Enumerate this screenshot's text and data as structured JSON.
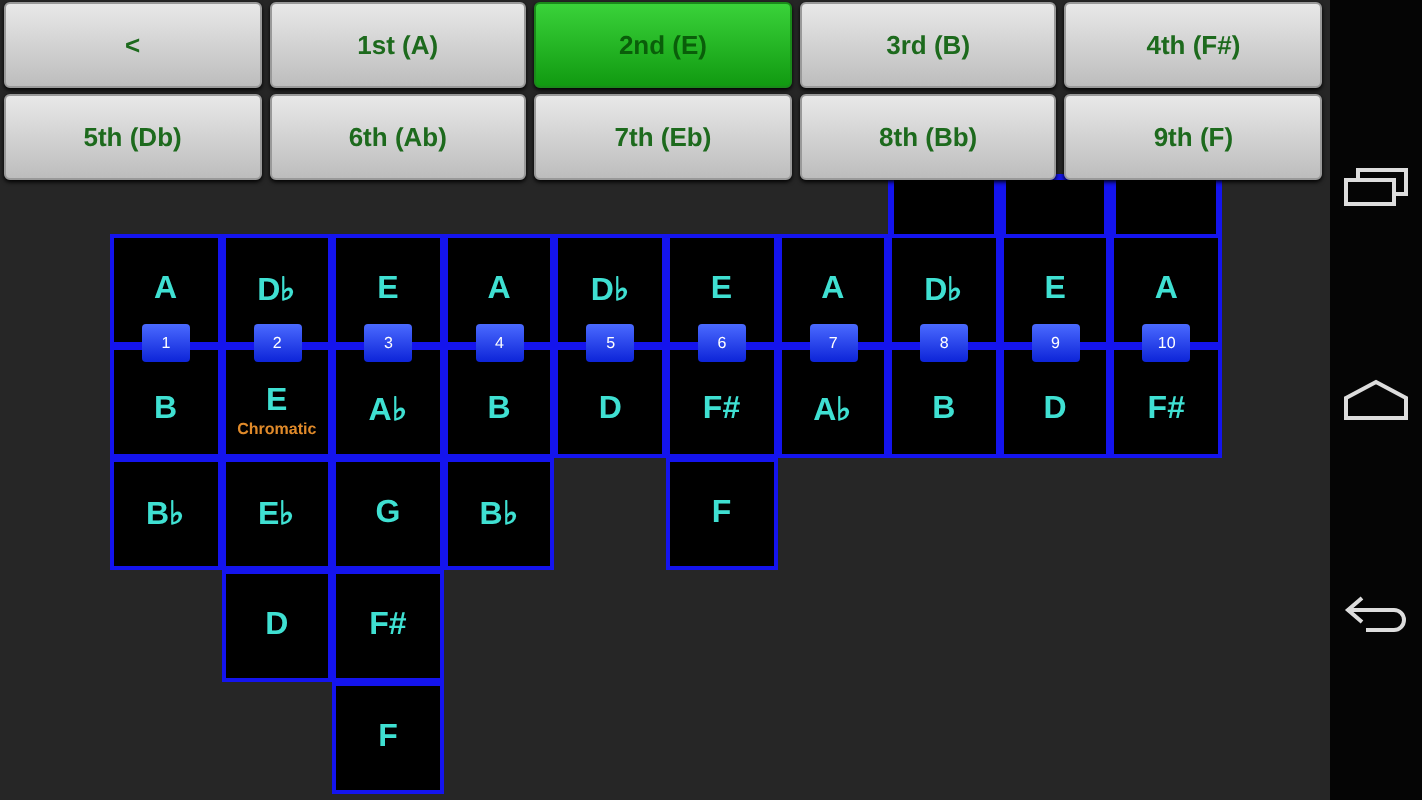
{
  "buttons": [
    {
      "label": "<",
      "selected": false
    },
    {
      "label": "1st (A)",
      "selected": false
    },
    {
      "label": "2nd (E)",
      "selected": true
    },
    {
      "label": "3rd (B)",
      "selected": false
    },
    {
      "label": "4th (F#)",
      "selected": false
    },
    {
      "label": "5th (Db)",
      "selected": false
    },
    {
      "label": "6th (Ab)",
      "selected": false
    },
    {
      "label": "7th (Eb)",
      "selected": false
    },
    {
      "label": "8th (Bb)",
      "selected": false
    },
    {
      "label": "9th (F)",
      "selected": false
    }
  ],
  "columns": [
    {
      "number": "1",
      "top": "A",
      "bottom": "B",
      "below": [
        "B♭"
      ]
    },
    {
      "number": "2",
      "top": "D♭",
      "bottom": "E",
      "label": "Chromatic",
      "below": [
        "E♭",
        "D"
      ]
    },
    {
      "number": "3",
      "top": "E",
      "bottom": "A♭",
      "below": [
        "G",
        "F#",
        "F"
      ]
    },
    {
      "number": "4",
      "top": "A",
      "bottom": "B",
      "below": [
        "B♭"
      ]
    },
    {
      "number": "5",
      "top": "D♭",
      "bottom": "D"
    },
    {
      "number": "6",
      "top": "E",
      "bottom": "F#",
      "below": [
        "F"
      ]
    },
    {
      "number": "7",
      "top": "A",
      "bottom": "A♭"
    },
    {
      "number": "8",
      "top": "D♭",
      "bottom": "B",
      "cut_above": true
    },
    {
      "number": "9",
      "top": "E",
      "bottom": "D",
      "cut_above": true
    },
    {
      "number": "10",
      "top": "A",
      "bottom": "F#",
      "cut_above": true
    }
  ]
}
